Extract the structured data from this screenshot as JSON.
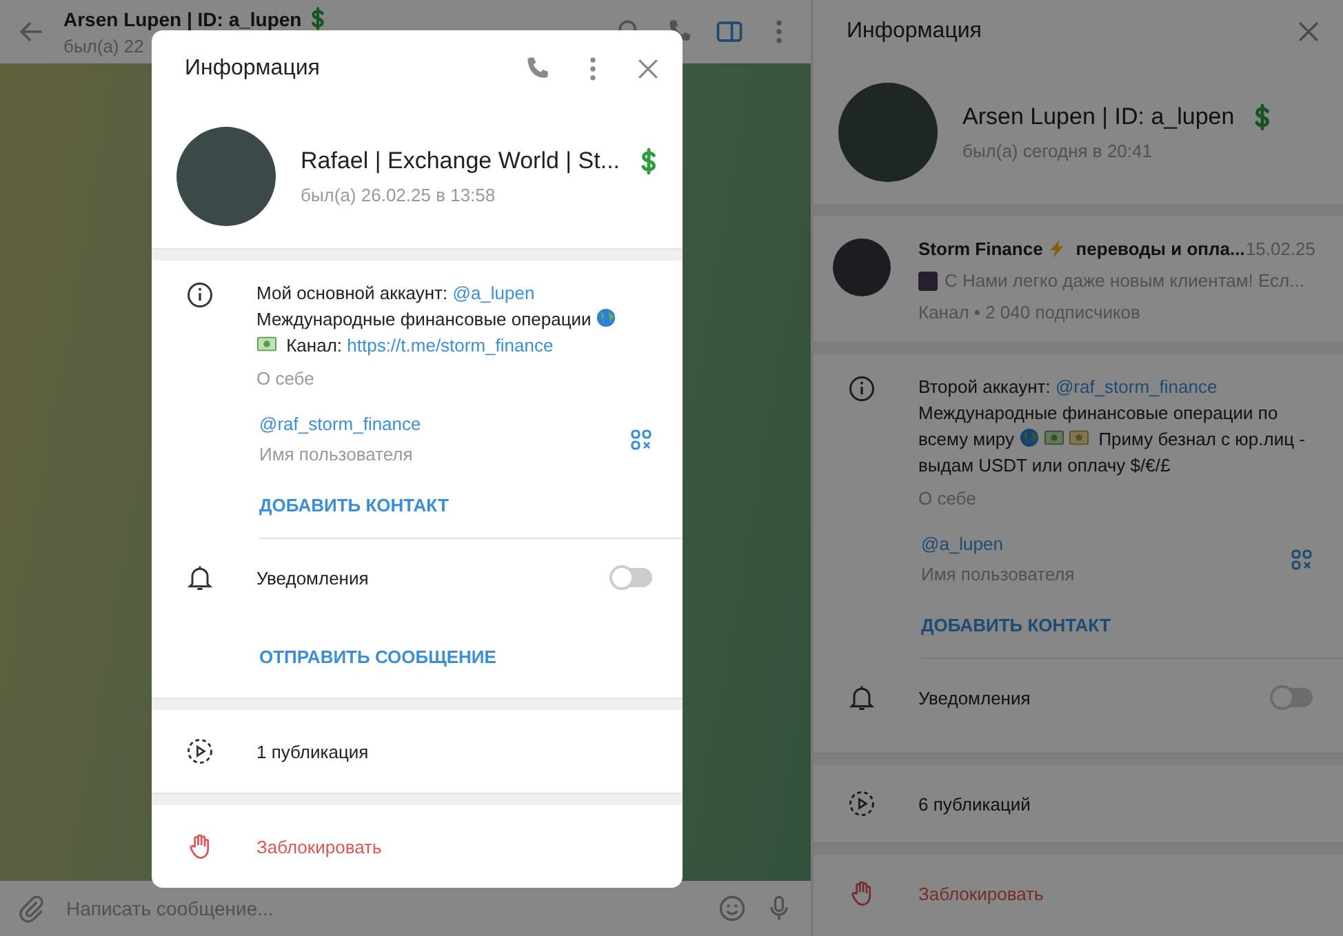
{
  "chat_header": {
    "title": "Arsen Lupen | ID: a_lupen",
    "status": "был(а) 22"
  },
  "composer": {
    "placeholder": "Написать сообщение..."
  },
  "panels": [
    {
      "kind": "dialog",
      "title": "Информация",
      "actions": [
        {
          "kind": "phone"
        },
        {
          "kind": "more"
        },
        {
          "kind": "close"
        }
      ],
      "profile": {
        "name": "Rafael | Exchange World | St...",
        "status": "был(а) 26.02.25 в 13:58"
      },
      "about": {
        "segments": [
          {
            "kind": "text",
            "text": "Мой основной аккаунт: "
          },
          {
            "kind": "link",
            "text": "@a_lupen"
          },
          {
            "kind": "break"
          },
          {
            "kind": "text",
            "text": "Международные финансовые операции "
          },
          {
            "kind": "globe"
          },
          {
            "kind": "break"
          },
          {
            "kind": "note_green"
          },
          {
            "kind": "text",
            "text": " Канал: "
          },
          {
            "kind": "link",
            "text": "https://t.me/storm_finance"
          }
        ],
        "caption": "О себе"
      },
      "username": {
        "value": "@raf_storm_finance",
        "caption": "Имя пользователя"
      },
      "add_contact": "ДОБАВИТЬ КОНТАКТ",
      "notifications": {
        "label": "Уведомления",
        "on": false
      },
      "send_message": "ОТПРАВИТЬ СООБЩЕНИЕ",
      "publications": "1 публикация",
      "block": "Заблокировать"
    },
    {
      "kind": "sidebar",
      "title": "Информация",
      "actions": [
        {
          "kind": "close"
        }
      ],
      "profile": {
        "name": "Arsen Lupen | ID: a_lupen",
        "status": "был(а) сегодня в 20:41"
      },
      "channel": {
        "name": [
          {
            "kind": "text",
            "text": "Storm Finance"
          },
          {
            "kind": "bolt"
          },
          {
            "kind": "text",
            "text": "переводы и опла..."
          }
        ],
        "date": "15.02.25",
        "preview": [
          {
            "kind": "thumbnail"
          },
          {
            "kind": "text",
            "text": "С Нами легко даже новым клиентам!  Есл..."
          }
        ],
        "meta": "Канал • 2 040 подписчиков"
      },
      "about": {
        "segments": [
          {
            "kind": "text",
            "text": "Второй аккаунт: "
          },
          {
            "kind": "link",
            "text": "@raf_storm_finance"
          },
          {
            "kind": "text",
            "text": " Международные финансовые операции по всему миру "
          },
          {
            "kind": "globe"
          },
          {
            "kind": "note_green"
          },
          {
            "kind": "note_yellow"
          },
          {
            "kind": "text",
            "text": " Приму безнал с юр.лиц - выдам USDT или оплачу $/€/£"
          }
        ],
        "caption": "О себе"
      },
      "username": {
        "value": "@a_lupen",
        "caption": "Имя пользователя"
      },
      "add_contact": "ДОБАВИТЬ КОНТАКТ",
      "notifications": {
        "label": "Уведомления",
        "on": false
      },
      "publications": "6 публикаций",
      "block": "Заблокировать"
    }
  ]
}
